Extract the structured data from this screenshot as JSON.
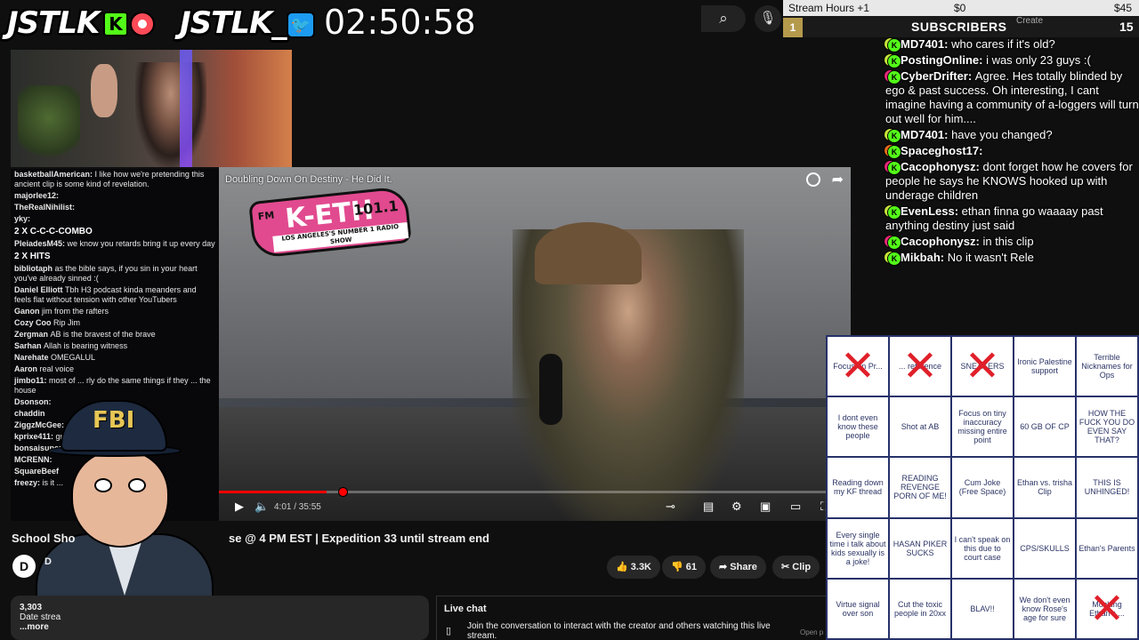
{
  "brand": {
    "logo_left": "JSTLK",
    "kick_letter": "K",
    "logo_right": "JSTLK_",
    "clock": "02:50:58"
  },
  "goals": {
    "stream_hours": "Stream Hours +1",
    "amount_current": "$0",
    "amount_goal": "$45",
    "rank": "1",
    "subscribers_label": "SUBSCRIBERS",
    "create": "Create",
    "subscribers_count": "15"
  },
  "video": {
    "title_overlay": "Doubling Down On Destiny - He Did It.",
    "station_fm": "FM",
    "station_name": "K-ETH",
    "station_freq": "101.1",
    "station_tagline": "LOS ANGELES'S NUMBER 1 RADIO SHOW",
    "time": "4:01 / 35:55",
    "progress": 0.17
  },
  "overlay_chat": [
    {
      "user": "basketballAmerican:",
      "text": "I like how we're pretending this ancient clip is some kind of revelation."
    },
    {
      "user": "majorlee12:",
      "text": ""
    },
    {
      "user": "TheRealNihilist:",
      "text": ""
    },
    {
      "user": "yky:",
      "text": ""
    },
    {
      "combo": "2 X C-C-C-COMBO"
    },
    {
      "user": "PleiadesM45:",
      "text": "we know you retards bring it up every day"
    },
    {
      "combo": "2 X HITS"
    },
    {
      "user": "bibliotaph",
      "text": "as the bible says, if you sin in your heart you've already sinned :("
    },
    {
      "user": "Daniel Elliott",
      "text": "Tbh H3 podcast kinda meanders and feels flat without tension with other YouTubers"
    },
    {
      "user": "Ganon",
      "text": "jim from the rafters"
    },
    {
      "user": "Cozy Coo",
      "text": "Rip Jim"
    },
    {
      "user": "Zergman",
      "text": "AB is the bravest of the brave"
    },
    {
      "user": "Sarhan",
      "text": "Allah is bearing witness"
    },
    {
      "user": "Narehate",
      "text": "OMEGALUL"
    },
    {
      "user": "Aaron",
      "text": "real voice"
    },
    {
      "user": "jimbo11:",
      "text": "most of ... rly do the same things if they ... the house"
    },
    {
      "user": "Dsonson:",
      "text": ""
    },
    {
      "user": "chaddin",
      "text": ""
    },
    {
      "user": "ZiggzMcGee:",
      "text": ""
    },
    {
      "user": "kprixe411:",
      "text": "gras..."
    },
    {
      "user": "bonsaisuperstar",
      "text": "... HIS PEARLS"
    },
    {
      "user": "MCRENN:",
      "text": ""
    },
    {
      "user": "SquareBeef",
      "text": ""
    },
    {
      "user": "freezy:",
      "text": "is it ..."
    }
  ],
  "below": {
    "title_left": "School Sho",
    "title_right": "se @ 4 PM EST | Expedition 33 until stream end",
    "channel_initial": "D",
    "channel_name": "D",
    "likes": "3.3K",
    "dislikes": "61",
    "share": "Share",
    "clip": "Clip",
    "views": "3,303",
    "date": "Date strea",
    "more": "...more",
    "live_chat": "Live chat",
    "join_text": "Join the conversation to interact with the creator and others watching this live stream.",
    "open_panel": "Open p"
  },
  "right_chat": [
    {
      "user": "MD7401:",
      "text": "who cares if it's old?",
      "color": "#c6e33a"
    },
    {
      "user": "PostingOnline:",
      "text": "i was only 23 guys :(",
      "color": "#c6e33a"
    },
    {
      "user": "CyberDrifter:",
      "text": "Agree. Hes totally blinded by ego & past success. Oh interesting, I cant imagine having a community of a-loggers will turn out well for him....",
      "color": "#e5267a"
    },
    {
      "user": "MD7401:",
      "text": "have you changed?",
      "color": "#c6e33a"
    },
    {
      "user": "Spaceghost17:",
      "text": "",
      "color": "#e56a1a"
    },
    {
      "user": "Cacophonysz:",
      "text": "dont forget how he covers for people he says he KNOWS hooked up with underage children",
      "color": "#e5267a"
    },
    {
      "user": "EvenLess:",
      "text": "ethan finna go waaaay past anything destiny just said",
      "color": "#c6e33a"
    },
    {
      "user": "Cacophonysz:",
      "text": "in this clip",
      "color": "#e5267a"
    },
    {
      "user": "Mikbah:",
      "text": "No it wasn't Rele",
      "color": "#c6e33a"
    }
  ],
  "bingo": [
    {
      "text": "Focus on Pr...",
      "marked": true
    },
    {
      "text": "... reference",
      "marked": true
    },
    {
      "text": "SNEAKERS",
      "marked": true
    },
    {
      "text": "Ironic Palestine support",
      "marked": false
    },
    {
      "text": "Terrible Nicknames for Ops",
      "marked": false
    },
    {
      "text": "I dont even know these people",
      "marked": false
    },
    {
      "text": "Shot at AB",
      "marked": false
    },
    {
      "text": "Focus on tiny inaccuracy missing entire point",
      "marked": false
    },
    {
      "text": "60 GB OF CP",
      "marked": false
    },
    {
      "text": "HOW THE FUCK YOU DO EVEN SAY THAT?",
      "marked": false
    },
    {
      "text": "Reading down my KF thread",
      "marked": false
    },
    {
      "text": "READING REVENGE PORN OF ME!",
      "marked": false
    },
    {
      "text": "Cum Joke (Free Space)",
      "marked": false
    },
    {
      "text": "Ethan vs. trisha Clip",
      "marked": false
    },
    {
      "text": "THIS IS UNHINGED!",
      "marked": false
    },
    {
      "text": "Every single time i talk about kids sexually is a joke!",
      "marked": false
    },
    {
      "text": "HASAN PIKER SUCKS",
      "marked": false
    },
    {
      "text": "I can't speak on this due to court case",
      "marked": false
    },
    {
      "text": "CPS/SKULLS",
      "marked": false
    },
    {
      "text": "Ethan's Parents",
      "marked": false
    },
    {
      "text": "Virtue signal over son",
      "marked": false
    },
    {
      "text": "Cut the toxic people in 20xx",
      "marked": false
    },
    {
      "text": "BLAV!!",
      "marked": false
    },
    {
      "text": "We don't even know Rose's age for sure",
      "marked": false
    },
    {
      "text": "Mocking Ethan's ...",
      "marked": true
    }
  ],
  "colors": {
    "kick_green": "#53fc18",
    "youtube_red": "#ff0000",
    "bingo_border": "#27316a",
    "mark_red": "#e0202a"
  }
}
